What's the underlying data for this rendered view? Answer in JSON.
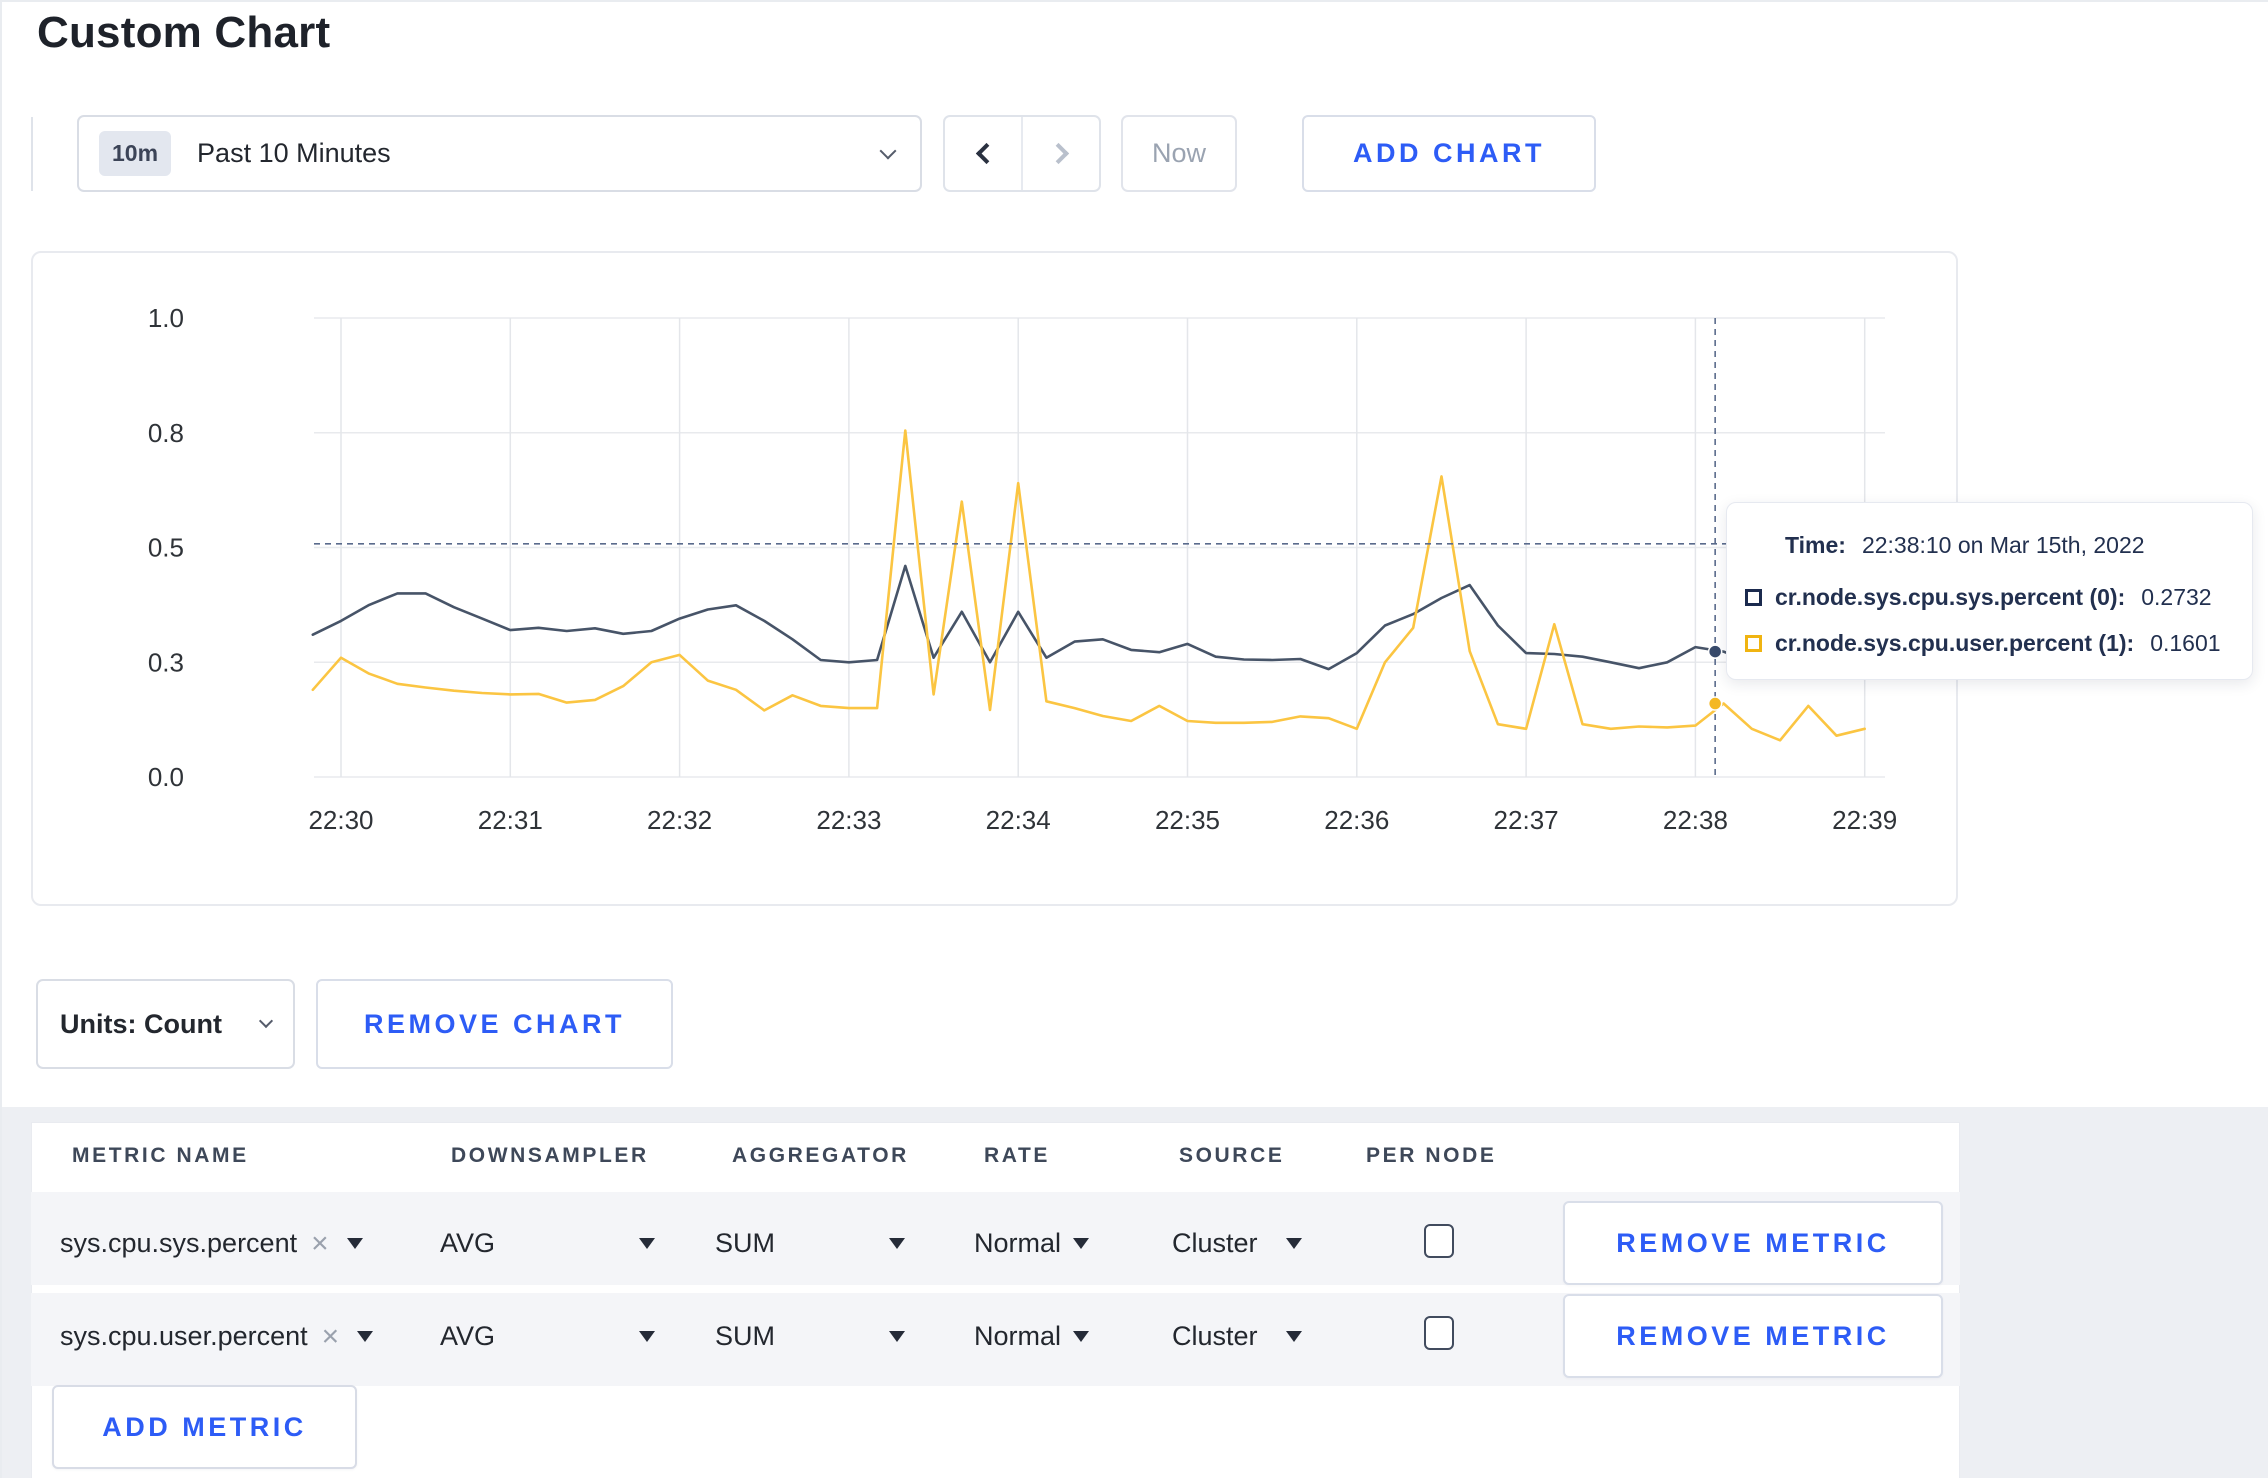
{
  "page": {
    "title": "Custom Chart"
  },
  "theme": {
    "accent": "#2d5cf6",
    "series_sys_color": "#475468",
    "series_user_color": "#fbc542",
    "swatch_sys_color": "#1b2a4e",
    "swatch_user_color": "#f0b411"
  },
  "toolbar": {
    "time_window_badge": "10m",
    "time_window_label": "Past 10 Minutes",
    "now_label": "Now",
    "add_chart_label": "ADD CHART"
  },
  "chart_card": {
    "tooltip": {
      "time_label": "Time:",
      "time_value": "22:38:10 on Mar 15th, 2022",
      "entries": [
        {
          "label": "cr.node.sys.cpu.sys.percent (0):",
          "value": "0.2732",
          "swatch": "#1b2a4e"
        },
        {
          "label": "cr.node.sys.cpu.user.percent (1):",
          "value": "0.1601",
          "swatch": "#f0b411"
        }
      ]
    }
  },
  "chart_data": {
    "type": "line",
    "title": "",
    "xlabel": "",
    "ylabel": "",
    "ylim": [
      0,
      1
    ],
    "grid": true,
    "legend_position": "none",
    "x_ticks": [
      "22:30",
      "22:31",
      "22:32",
      "22:33",
      "22:34",
      "22:35",
      "22:36",
      "22:37",
      "22:38",
      "22:39"
    ],
    "y_ticks": [
      "1.0",
      "0.8",
      "0.5",
      "0.3",
      "0.0"
    ],
    "y_tick_values": [
      1.0,
      0.75,
      0.5,
      0.25,
      0.0
    ],
    "start_offset_seconds": -10,
    "sample_interval_seconds": 10,
    "series": [
      {
        "name": "cr.node.sys.cpu.sys.percent",
        "color": "#475468",
        "values": [
          0.31,
          0.34,
          0.375,
          0.4,
          0.4,
          0.37,
          0.345,
          0.32,
          0.325,
          0.318,
          0.324,
          0.312,
          0.318,
          0.345,
          0.365,
          0.374,
          0.34,
          0.3,
          0.255,
          0.25,
          0.255,
          0.46,
          0.26,
          0.36,
          0.25,
          0.36,
          0.26,
          0.295,
          0.3,
          0.277,
          0.272,
          0.29,
          0.262,
          0.256,
          0.255,
          0.257,
          0.235,
          0.27,
          0.33,
          0.355,
          0.39,
          0.418,
          0.33,
          0.27,
          0.268,
          0.262,
          0.25,
          0.237,
          0.25,
          0.283,
          0.2732,
          0.25,
          0.25,
          0.26,
          0.28,
          0.3
        ]
      },
      {
        "name": "cr.node.sys.cpu.user.percent",
        "color": "#fbc542",
        "values": [
          0.19,
          0.26,
          0.225,
          0.203,
          0.195,
          0.188,
          0.183,
          0.18,
          0.181,
          0.162,
          0.168,
          0.198,
          0.25,
          0.266,
          0.21,
          0.19,
          0.145,
          0.178,
          0.155,
          0.15,
          0.15,
          0.755,
          0.18,
          0.6,
          0.146,
          0.64,
          0.165,
          0.15,
          0.133,
          0.122,
          0.155,
          0.122,
          0.118,
          0.118,
          0.12,
          0.132,
          0.128,
          0.105,
          0.25,
          0.325,
          0.655,
          0.274,
          0.115,
          0.105,
          0.333,
          0.115,
          0.105,
          0.11,
          0.108,
          0.112,
          0.1601,
          0.105,
          0.08,
          0.155,
          0.09,
          0.105
        ]
      }
    ],
    "hover": {
      "offset_seconds": 487,
      "guide_value": 0.508,
      "points": [
        {
          "value": 0.2732,
          "color": "#384a6b"
        },
        {
          "value": 0.1601,
          "color": "#f4b824"
        }
      ]
    }
  },
  "units_bar": {
    "units_label": "Units: Count",
    "remove_chart_label": "REMOVE CHART"
  },
  "metrics_table": {
    "headers": [
      "METRIC NAME",
      "DOWNSAMPLER",
      "AGGREGATOR",
      "RATE",
      "SOURCE",
      "PER NODE"
    ],
    "rows": [
      {
        "metric": "sys.cpu.sys.percent",
        "downsampler": "AVG",
        "aggregator": "SUM",
        "rate": "Normal",
        "source": "Cluster",
        "per_node_checked": false,
        "remove_label": "REMOVE METRIC"
      },
      {
        "metric": "sys.cpu.user.percent",
        "downsampler": "AVG",
        "aggregator": "SUM",
        "rate": "Normal",
        "source": "Cluster",
        "per_node_checked": false,
        "remove_label": "REMOVE METRIC"
      }
    ],
    "add_metric_label": "ADD METRIC"
  }
}
